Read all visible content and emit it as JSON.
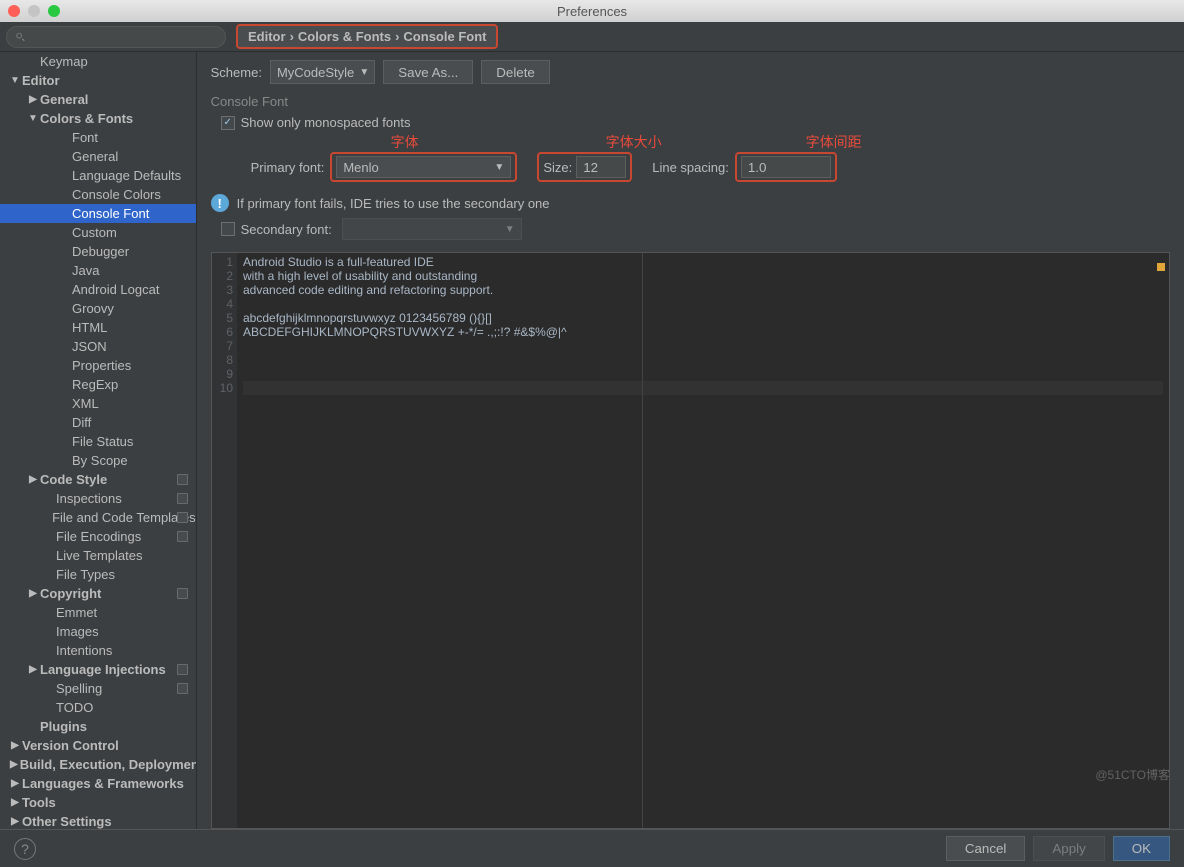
{
  "window": {
    "title": "Preferences"
  },
  "breadcrumb": {
    "p0": "Editor",
    "p1": "Colors & Fonts",
    "p2": "Console Font",
    "sep": "›"
  },
  "scheme": {
    "label": "Scheme:",
    "value": "MyCodeStyle",
    "saveAs": "Save As...",
    "delete": "Delete"
  },
  "section": {
    "title": "Console Font"
  },
  "form": {
    "showMono": "Show only monospaced fonts",
    "primaryLabel": "Primary font:",
    "primaryValue": "Menlo",
    "sizeLabel": "Size:",
    "sizeValue": "12",
    "spacingLabel": "Line spacing:",
    "spacingValue": "1.0",
    "info": "If primary font fails, IDE tries to use the secondary one",
    "secondaryLabel": "Secondary font:"
  },
  "annotations": {
    "font": "字体",
    "size": "字体大小",
    "spacing": "字体间距"
  },
  "preview": {
    "lines": [
      "Android Studio is a full-featured IDE",
      "with a high level of usability and outstanding",
      "advanced code editing and refactoring support.",
      "",
      "abcdefghijklmnopqrstuvwxyz 0123456789 (){}[]",
      "ABCDEFGHIJKLMNOPQRSTUVWXYZ +-*/= .,;:!? #&$%@|^",
      "",
      "",
      "",
      ""
    ]
  },
  "sidebar": {
    "items": [
      {
        "l": "Keymap",
        "d": 1,
        "a": ""
      },
      {
        "l": "Editor",
        "d": 0,
        "a": "▼",
        "b": true
      },
      {
        "l": "General",
        "d": 1,
        "a": "▶",
        "b": true
      },
      {
        "l": "Colors & Fonts",
        "d": 1,
        "a": "▼",
        "b": true
      },
      {
        "l": "Font",
        "d": 3,
        "a": ""
      },
      {
        "l": "General",
        "d": 3,
        "a": ""
      },
      {
        "l": "Language Defaults",
        "d": 3,
        "a": ""
      },
      {
        "l": "Console Colors",
        "d": 3,
        "a": ""
      },
      {
        "l": "Console Font",
        "d": 3,
        "a": "",
        "sel": true
      },
      {
        "l": "Custom",
        "d": 3,
        "a": ""
      },
      {
        "l": "Debugger",
        "d": 3,
        "a": ""
      },
      {
        "l": "Java",
        "d": 3,
        "a": ""
      },
      {
        "l": "Android Logcat",
        "d": 3,
        "a": ""
      },
      {
        "l": "Groovy",
        "d": 3,
        "a": ""
      },
      {
        "l": "HTML",
        "d": 3,
        "a": ""
      },
      {
        "l": "JSON",
        "d": 3,
        "a": ""
      },
      {
        "l": "Properties",
        "d": 3,
        "a": ""
      },
      {
        "l": "RegExp",
        "d": 3,
        "a": ""
      },
      {
        "l": "XML",
        "d": 3,
        "a": ""
      },
      {
        "l": "Diff",
        "d": 3,
        "a": ""
      },
      {
        "l": "File Status",
        "d": 3,
        "a": ""
      },
      {
        "l": "By Scope",
        "d": 3,
        "a": ""
      },
      {
        "l": "Code Style",
        "d": 1,
        "a": "▶",
        "b": true,
        "c": true
      },
      {
        "l": "Inspections",
        "d": 2,
        "a": "",
        "c": true
      },
      {
        "l": "File and Code Templates",
        "d": 2,
        "a": "",
        "c": true
      },
      {
        "l": "File Encodings",
        "d": 2,
        "a": "",
        "c": true
      },
      {
        "l": "Live Templates",
        "d": 2,
        "a": ""
      },
      {
        "l": "File Types",
        "d": 2,
        "a": ""
      },
      {
        "l": "Copyright",
        "d": 1,
        "a": "▶",
        "b": true,
        "c": true
      },
      {
        "l": "Emmet",
        "d": 2,
        "a": ""
      },
      {
        "l": "Images",
        "d": 2,
        "a": ""
      },
      {
        "l": "Intentions",
        "d": 2,
        "a": ""
      },
      {
        "l": "Language Injections",
        "d": 1,
        "a": "▶",
        "b": true,
        "c": true
      },
      {
        "l": "Spelling",
        "d": 2,
        "a": "",
        "c": true
      },
      {
        "l": "TODO",
        "d": 2,
        "a": ""
      },
      {
        "l": "Plugins",
        "d": 1,
        "a": "",
        "b": true
      },
      {
        "l": "Version Control",
        "d": 0,
        "a": "▶",
        "b": true
      },
      {
        "l": "Build, Execution, Deployment",
        "d": 0,
        "a": "▶",
        "b": true
      },
      {
        "l": "Languages & Frameworks",
        "d": 0,
        "a": "▶",
        "b": true
      },
      {
        "l": "Tools",
        "d": 0,
        "a": "▶",
        "b": true
      },
      {
        "l": "Other Settings",
        "d": 0,
        "a": "▶",
        "b": true
      }
    ]
  },
  "footer": {
    "cancel": "Cancel",
    "apply": "Apply",
    "ok": "OK"
  },
  "watermark": "@51CTO博客"
}
